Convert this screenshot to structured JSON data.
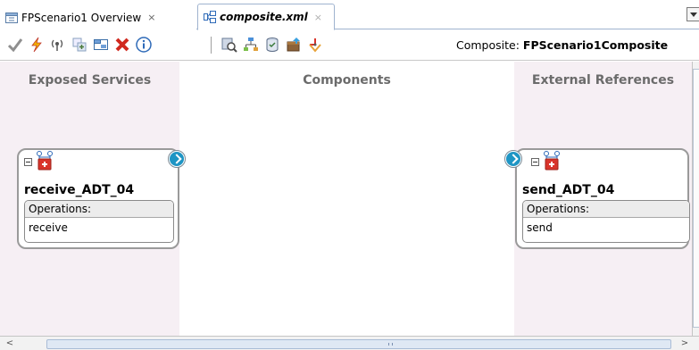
{
  "tabs": [
    {
      "label": "FPScenario1 Overview",
      "close": "×",
      "active": false
    },
    {
      "label": "composite.xml",
      "close": "×",
      "active": true
    }
  ],
  "toolbar": {
    "icons": [
      "validate-icon",
      "lightning-icon",
      "wireless-icon",
      "add-component-icon",
      "group-icon",
      "delete-icon",
      "info-icon",
      "search-icon",
      "tree-icon",
      "database-icon",
      "deploy-icon",
      "trace-icon"
    ],
    "composite_label": "Composite:",
    "composite_name": "FPScenario1Composite"
  },
  "lanes": {
    "left_title": "Exposed Services",
    "middle_title": "Components",
    "right_title": "External References"
  },
  "services": [
    {
      "name": "receive_ADT_04",
      "ops_header": "Operations:",
      "operation": "receive"
    }
  ],
  "references": [
    {
      "name": "send_ADT_04",
      "ops_header": "Operations:",
      "operation": "send"
    }
  ],
  "scrollbar": {
    "left_arrow": "<",
    "right_arrow": ">"
  },
  "colors": {
    "lane_bg": "#f6eff4",
    "accent": "#1e95c4",
    "adapter_red": "#d9342b"
  }
}
